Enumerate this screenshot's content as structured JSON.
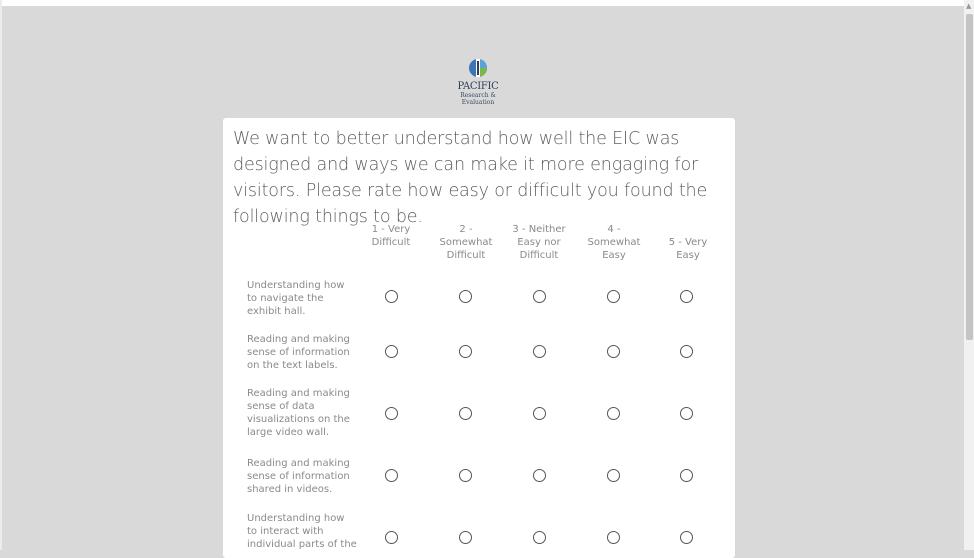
{
  "logo": {
    "line1": "PACIFIC",
    "line2": "Research &",
    "line3": "Evaluation"
  },
  "question": "We want to better understand how well the EIC was designed and ways we can make it more engaging for visitors. Please rate how easy or difficult you found the following things to be.",
  "columns": [
    "1 - Very Difficult",
    "2 - Somewhat Difficult",
    "3 - Neither Easy nor Difficult",
    "4 - Somewhat Easy",
    "5 - Very Easy"
  ],
  "rows": [
    "Understanding how to navigate the exhibit hall.",
    "Reading and making sense of information on the text labels.",
    "Reading and making sense of data visualizations on the large video wall.",
    "Reading and making sense of information shared in videos.",
    "Understanding how to interact with individual parts of the"
  ]
}
